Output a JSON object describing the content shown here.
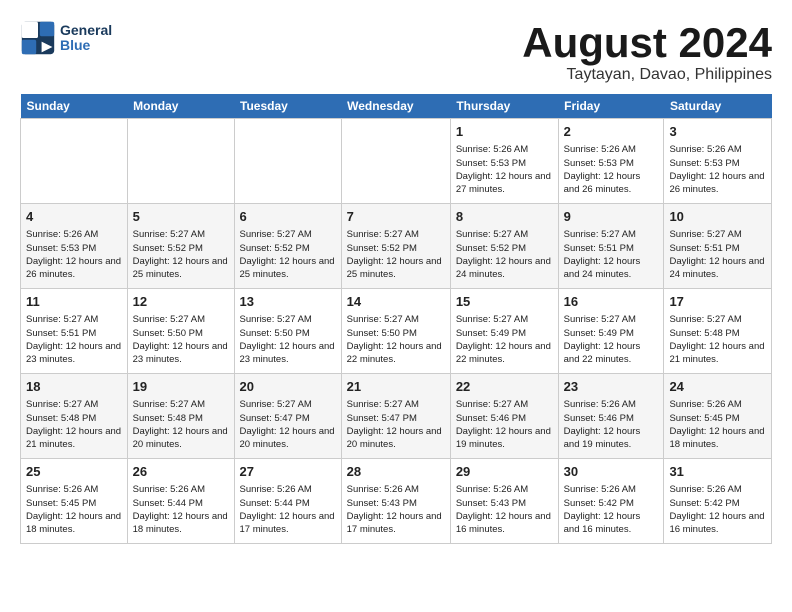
{
  "header": {
    "logo_text_general": "General",
    "logo_text_blue": "Blue",
    "month_year": "August 2024",
    "location": "Taytayan, Davao, Philippines"
  },
  "calendar": {
    "days_of_week": [
      "Sunday",
      "Monday",
      "Tuesday",
      "Wednesday",
      "Thursday",
      "Friday",
      "Saturday"
    ],
    "weeks": [
      [
        {
          "day": "",
          "info": ""
        },
        {
          "day": "",
          "info": ""
        },
        {
          "day": "",
          "info": ""
        },
        {
          "day": "",
          "info": ""
        },
        {
          "day": "1",
          "info": "Sunrise: 5:26 AM\nSunset: 5:53 PM\nDaylight: 12 hours and 27 minutes."
        },
        {
          "day": "2",
          "info": "Sunrise: 5:26 AM\nSunset: 5:53 PM\nDaylight: 12 hours and 26 minutes."
        },
        {
          "day": "3",
          "info": "Sunrise: 5:26 AM\nSunset: 5:53 PM\nDaylight: 12 hours and 26 minutes."
        }
      ],
      [
        {
          "day": "4",
          "info": "Sunrise: 5:26 AM\nSunset: 5:53 PM\nDaylight: 12 hours and 26 minutes."
        },
        {
          "day": "5",
          "info": "Sunrise: 5:27 AM\nSunset: 5:52 PM\nDaylight: 12 hours and 25 minutes."
        },
        {
          "day": "6",
          "info": "Sunrise: 5:27 AM\nSunset: 5:52 PM\nDaylight: 12 hours and 25 minutes."
        },
        {
          "day": "7",
          "info": "Sunrise: 5:27 AM\nSunset: 5:52 PM\nDaylight: 12 hours and 25 minutes."
        },
        {
          "day": "8",
          "info": "Sunrise: 5:27 AM\nSunset: 5:52 PM\nDaylight: 12 hours and 24 minutes."
        },
        {
          "day": "9",
          "info": "Sunrise: 5:27 AM\nSunset: 5:51 PM\nDaylight: 12 hours and 24 minutes."
        },
        {
          "day": "10",
          "info": "Sunrise: 5:27 AM\nSunset: 5:51 PM\nDaylight: 12 hours and 24 minutes."
        }
      ],
      [
        {
          "day": "11",
          "info": "Sunrise: 5:27 AM\nSunset: 5:51 PM\nDaylight: 12 hours and 23 minutes."
        },
        {
          "day": "12",
          "info": "Sunrise: 5:27 AM\nSunset: 5:50 PM\nDaylight: 12 hours and 23 minutes."
        },
        {
          "day": "13",
          "info": "Sunrise: 5:27 AM\nSunset: 5:50 PM\nDaylight: 12 hours and 23 minutes."
        },
        {
          "day": "14",
          "info": "Sunrise: 5:27 AM\nSunset: 5:50 PM\nDaylight: 12 hours and 22 minutes."
        },
        {
          "day": "15",
          "info": "Sunrise: 5:27 AM\nSunset: 5:49 PM\nDaylight: 12 hours and 22 minutes."
        },
        {
          "day": "16",
          "info": "Sunrise: 5:27 AM\nSunset: 5:49 PM\nDaylight: 12 hours and 22 minutes."
        },
        {
          "day": "17",
          "info": "Sunrise: 5:27 AM\nSunset: 5:48 PM\nDaylight: 12 hours and 21 minutes."
        }
      ],
      [
        {
          "day": "18",
          "info": "Sunrise: 5:27 AM\nSunset: 5:48 PM\nDaylight: 12 hours and 21 minutes."
        },
        {
          "day": "19",
          "info": "Sunrise: 5:27 AM\nSunset: 5:48 PM\nDaylight: 12 hours and 20 minutes."
        },
        {
          "day": "20",
          "info": "Sunrise: 5:27 AM\nSunset: 5:47 PM\nDaylight: 12 hours and 20 minutes."
        },
        {
          "day": "21",
          "info": "Sunrise: 5:27 AM\nSunset: 5:47 PM\nDaylight: 12 hours and 20 minutes."
        },
        {
          "day": "22",
          "info": "Sunrise: 5:27 AM\nSunset: 5:46 PM\nDaylight: 12 hours and 19 minutes."
        },
        {
          "day": "23",
          "info": "Sunrise: 5:26 AM\nSunset: 5:46 PM\nDaylight: 12 hours and 19 minutes."
        },
        {
          "day": "24",
          "info": "Sunrise: 5:26 AM\nSunset: 5:45 PM\nDaylight: 12 hours and 18 minutes."
        }
      ],
      [
        {
          "day": "25",
          "info": "Sunrise: 5:26 AM\nSunset: 5:45 PM\nDaylight: 12 hours and 18 minutes."
        },
        {
          "day": "26",
          "info": "Sunrise: 5:26 AM\nSunset: 5:44 PM\nDaylight: 12 hours and 18 minutes."
        },
        {
          "day": "27",
          "info": "Sunrise: 5:26 AM\nSunset: 5:44 PM\nDaylight: 12 hours and 17 minutes."
        },
        {
          "day": "28",
          "info": "Sunrise: 5:26 AM\nSunset: 5:43 PM\nDaylight: 12 hours and 17 minutes."
        },
        {
          "day": "29",
          "info": "Sunrise: 5:26 AM\nSunset: 5:43 PM\nDaylight: 12 hours and 16 minutes."
        },
        {
          "day": "30",
          "info": "Sunrise: 5:26 AM\nSunset: 5:42 PM\nDaylight: 12 hours and 16 minutes."
        },
        {
          "day": "31",
          "info": "Sunrise: 5:26 AM\nSunset: 5:42 PM\nDaylight: 12 hours and 16 minutes."
        }
      ]
    ]
  }
}
